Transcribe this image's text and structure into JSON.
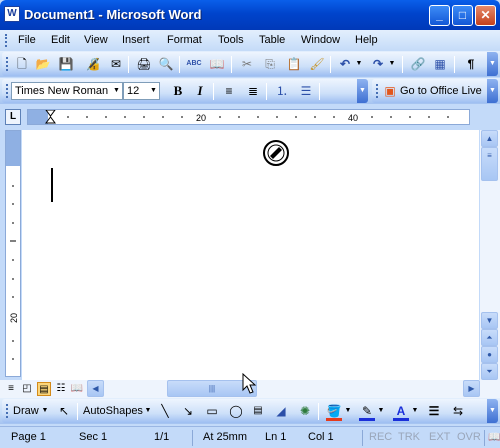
{
  "window": {
    "title": "Document1 - Microsoft Word",
    "app_icon_letter": "W"
  },
  "titlebar_buttons": {
    "minimize": "_",
    "maximize": "□",
    "close": "✕"
  },
  "menu": [
    "File",
    "Edit",
    "View",
    "Insert",
    "Format",
    "Tools",
    "Table",
    "Window",
    "Help"
  ],
  "standard_toolbar": {
    "icons": [
      "new-icon",
      "open-icon",
      "save-icon",
      "permission-icon",
      "email-icon",
      "print-icon",
      "print-preview-icon",
      "spelling-icon",
      "research-icon",
      "cut-icon",
      "copy-icon",
      "paste-icon",
      "format-painter-icon",
      "undo-icon",
      "redo-icon",
      "hyperlink-icon",
      "tables-borders-icon",
      "show-formatting-icon"
    ],
    "glyphs": [
      "🗋",
      "📂",
      "💾",
      "🔏",
      "✉",
      "🖨",
      "🔍",
      "ABC",
      "📖",
      "✂",
      "⎘",
      "📋",
      "🖌",
      "↶",
      "↷",
      "🔗",
      "▦",
      "¶"
    ]
  },
  "formatting_toolbar": {
    "font": "Times New Roman",
    "size": "12",
    "bold": "B",
    "italic": "I",
    "office_live_button": "Go to Office Live"
  },
  "ruler": {
    "tick_labels": [
      "20",
      "40"
    ]
  },
  "vruler": {
    "tick_labels": [
      "20"
    ]
  },
  "drawing_toolbar": {
    "draw_label": "Draw",
    "autoshapes_label": "AutoShapes"
  },
  "status": {
    "page": "Page 1",
    "section": "Sec 1",
    "pages": "1/1",
    "at": "At 25mm",
    "line": "Ln 1",
    "col": "Col 1",
    "modes": [
      "REC",
      "TRK",
      "EXT",
      "OVR"
    ]
  },
  "colors": {
    "titlebar": "#0044cc",
    "chrome": "#c3daf9",
    "font_color": "#1a2fd9",
    "highlight_color": "#f5e52a",
    "fill_color": "#e53a1c"
  }
}
